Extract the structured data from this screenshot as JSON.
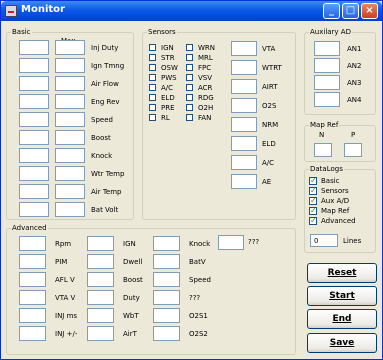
{
  "window": {
    "title": "Monitor",
    "minimize": "_",
    "maximize": "□",
    "close": "×"
  },
  "basic": {
    "legend": "Basic",
    "max_label": "Max",
    "labels": [
      "Inj Duty",
      "Ign Tmng",
      "Air Flow",
      "Eng Rev",
      "Speed",
      "Boost",
      "Knock",
      "Wtr Temp",
      "Air Temp",
      "Bat Volt"
    ]
  },
  "sensors": {
    "legend": "Sensors",
    "col1": [
      "IGN",
      "STR",
      "OSW",
      "PWS",
      "A/C",
      "ELD",
      "PRE",
      "RL"
    ],
    "col2": [
      "WRN",
      "MRL",
      "FPC",
      "VSV",
      "ACR",
      "RDG",
      "O2H",
      "FAN"
    ],
    "fields": [
      "VTA",
      "WTRT",
      "AIRT",
      "O2S",
      "NRM",
      "ELD",
      "A/C",
      "AE"
    ]
  },
  "aux": {
    "legend": "Auxilary AD",
    "labels": [
      "AN1",
      "AN2",
      "AN3",
      "AN4"
    ]
  },
  "mapref": {
    "legend": "Map Ref",
    "n": "N",
    "p": "P"
  },
  "datalog": {
    "legend": "DataLogs",
    "items": [
      "Basic",
      "Sensors",
      "Aux A/D",
      "Map Ref",
      "Advanced"
    ],
    "lines_value": "0",
    "lines_label": "Lines"
  },
  "advanced": {
    "legend": "Advanced",
    "col1": [
      "Rpm",
      "PIM",
      "AFL V",
      "VTA V",
      "INJ ms",
      "INJ +/-"
    ],
    "col2": [
      "IGN",
      "Dwell",
      "Boost",
      "Duty",
      "WbT",
      "AirT"
    ],
    "col3": [
      "Knock",
      "BatV",
      "Speed",
      "???",
      "O2S1",
      "O2S2"
    ],
    "extra": "???"
  },
  "buttons": {
    "reset": "Reset",
    "start": "Start",
    "end": "End",
    "save": "Save"
  }
}
